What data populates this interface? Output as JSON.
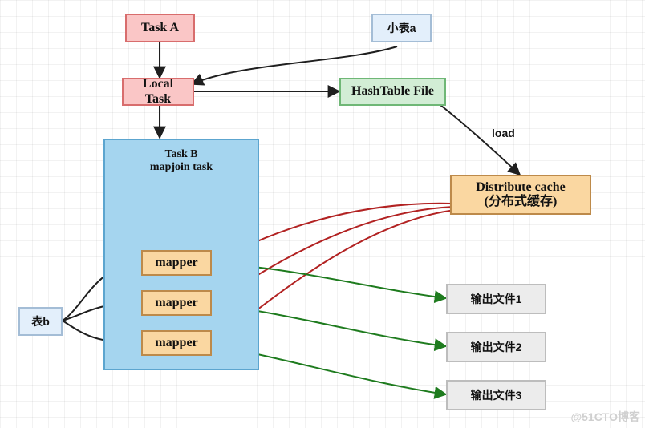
{
  "nodes": {
    "taskA": "Task A",
    "smallTableA": "小表a",
    "localTask": "Local Task",
    "hashTableFile": "HashTable File",
    "distributeCache": "Distribute cache\n(分布式缓存)",
    "tableB": "表b",
    "taskBPanel": "Task B\nmapjoin task",
    "mapper1": "mapper",
    "mapper2": "mapper",
    "mapper3": "mapper",
    "out1": "输出文件1",
    "out2": "输出文件2",
    "out3": "输出文件3"
  },
  "edgeLabel": {
    "load": "load"
  },
  "watermark": "@51CTO博客"
}
